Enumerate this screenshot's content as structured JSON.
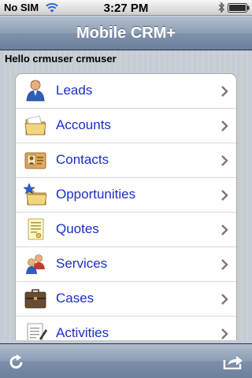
{
  "status_bar": {
    "carrier": "No SIM",
    "time": "3:27 PM",
    "icons": [
      "wifi-icon",
      "bluetooth-icon",
      "battery-icon"
    ]
  },
  "nav": {
    "title": "Mobile CRM+"
  },
  "greeting": "Hello crmuser crmuser",
  "menu": {
    "items": [
      {
        "label": "Leads",
        "icon": "leads-icon"
      },
      {
        "label": "Accounts",
        "icon": "accounts-folder-icon"
      },
      {
        "label": "Contacts",
        "icon": "contacts-card-icon"
      },
      {
        "label": "Opportunities",
        "icon": "opportunities-folder-star-icon"
      },
      {
        "label": "Quotes",
        "icon": "quotes-document-icon"
      },
      {
        "label": "Services",
        "icon": "services-people-icon"
      },
      {
        "label": "Cases",
        "icon": "cases-briefcase-icon"
      },
      {
        "label": "Activities",
        "icon": "activities-notepad-icon"
      }
    ]
  },
  "toolbar": {
    "left_icon": "refresh-icon",
    "right_icon": "share-icon"
  },
  "colors": {
    "link_blue": "#1a2fc8",
    "nav_bar": "#8192ab",
    "background": "#c5ccd4"
  }
}
